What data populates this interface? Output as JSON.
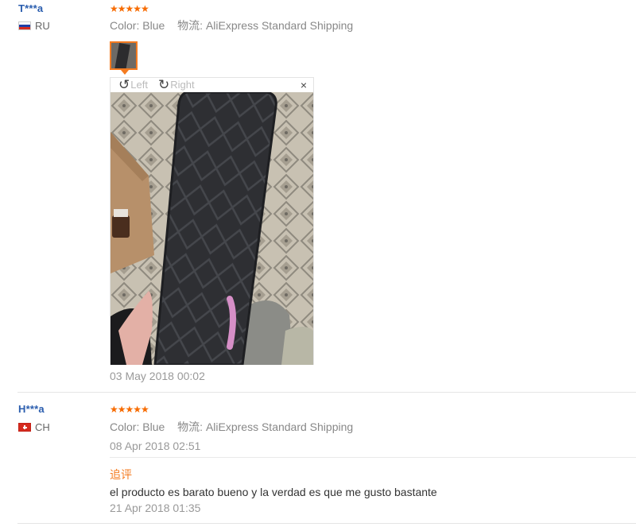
{
  "reviews": [
    {
      "user": "T***a",
      "country": "RU",
      "rating": "★★★★★",
      "color_label": "Color:",
      "color_value": "Blue",
      "shipping_label": "物流:",
      "shipping_value": "AliExpress Standard Shipping",
      "viewer": {
        "left_label": "Left",
        "right_label": "Right",
        "close": "×"
      },
      "date": "03 May 2018 00:02"
    },
    {
      "user": "H***a",
      "country": "CH",
      "rating": "★★★★★",
      "color_label": "Color:",
      "color_value": "Blue",
      "shipping_label": "物流:",
      "shipping_value": "AliExpress Standard Shipping",
      "date": "08 Apr 2018 02:51",
      "followup_label": "追评",
      "followup_text": "el producto es barato bueno y la verdad es que me gusto bastante",
      "followup_date": "21 Apr 2018 01:35"
    }
  ],
  "colors": {
    "accent": "#f47b20",
    "username": "#2a5dae",
    "stars": "#f76b00"
  }
}
